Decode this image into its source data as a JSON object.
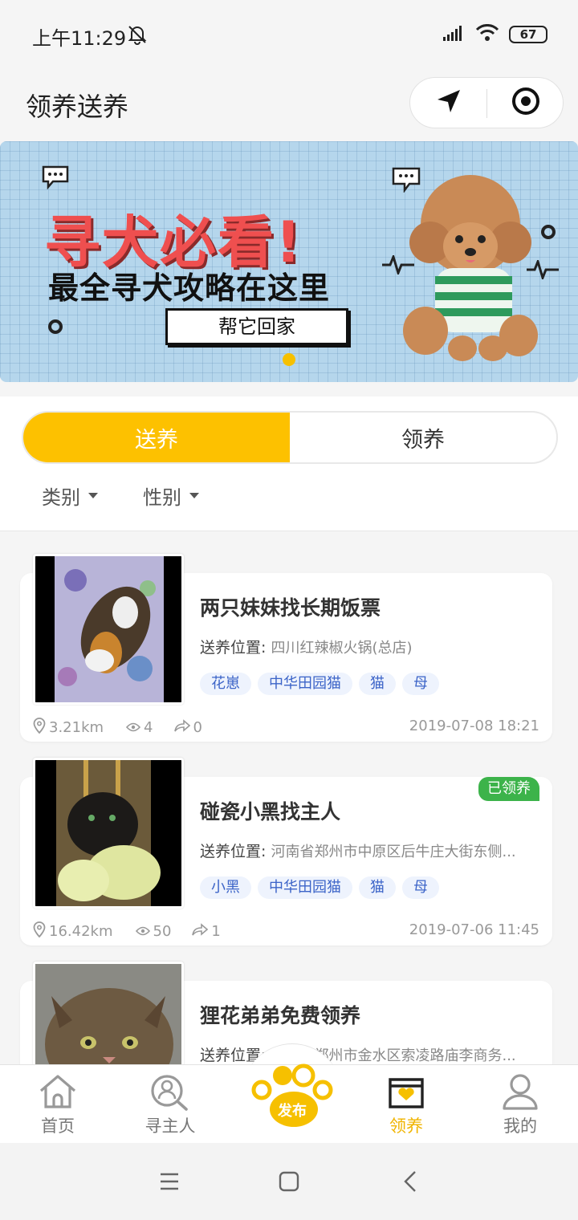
{
  "status_bar": {
    "time": "上午11:29",
    "battery": "67"
  },
  "header": {
    "title": "领养送养"
  },
  "banner": {
    "headline": "寻犬必看!",
    "subline": "最全寻犬攻略在这里",
    "bubble": "帮它回家"
  },
  "segment": {
    "tabs": [
      "送养",
      "领养"
    ],
    "active": 0
  },
  "filters": [
    "类别",
    "性别"
  ],
  "posts": [
    {
      "title": "两只妹妹找长期饭票",
      "location_label": "送养位置",
      "location": "四川红辣椒火锅(总店)",
      "tags": [
        "花崽",
        "中华田园猫",
        "猫",
        "母"
      ],
      "distance": "3.21km",
      "views": "4",
      "shares": "0",
      "date": "2019-07-08 18:21",
      "badge": ""
    },
    {
      "title": "碰瓷小黑找主人",
      "location_label": "送养位置",
      "location": "河南省郑州市中原区后牛庄大街东侧...",
      "tags": [
        "小黑",
        "中华田园猫",
        "猫",
        "母"
      ],
      "distance": "16.42km",
      "views": "50",
      "shares": "1",
      "date": "2019-07-06 11:45",
      "badge": "已领养"
    },
    {
      "title": "狸花弟弟免费领养",
      "location_label": "送养位置",
      "location": "河南省郑州市金水区索凌路庙李商务...",
      "tags": [],
      "distance": "",
      "views": "",
      "shares": "",
      "date": "",
      "badge": ""
    }
  ],
  "tabbar": {
    "items": [
      {
        "label": "首页",
        "icon": "home-icon"
      },
      {
        "label": "寻主人",
        "icon": "find-owner-icon"
      },
      {
        "label": "发布",
        "icon": "paw-icon"
      },
      {
        "label": "领养",
        "icon": "adopt-box-icon"
      },
      {
        "label": "我的",
        "icon": "user-icon"
      }
    ],
    "active": 3
  },
  "colors": {
    "accent": "#fdc100",
    "badge": "#3cb34a",
    "tag_text": "#3c64c8"
  }
}
